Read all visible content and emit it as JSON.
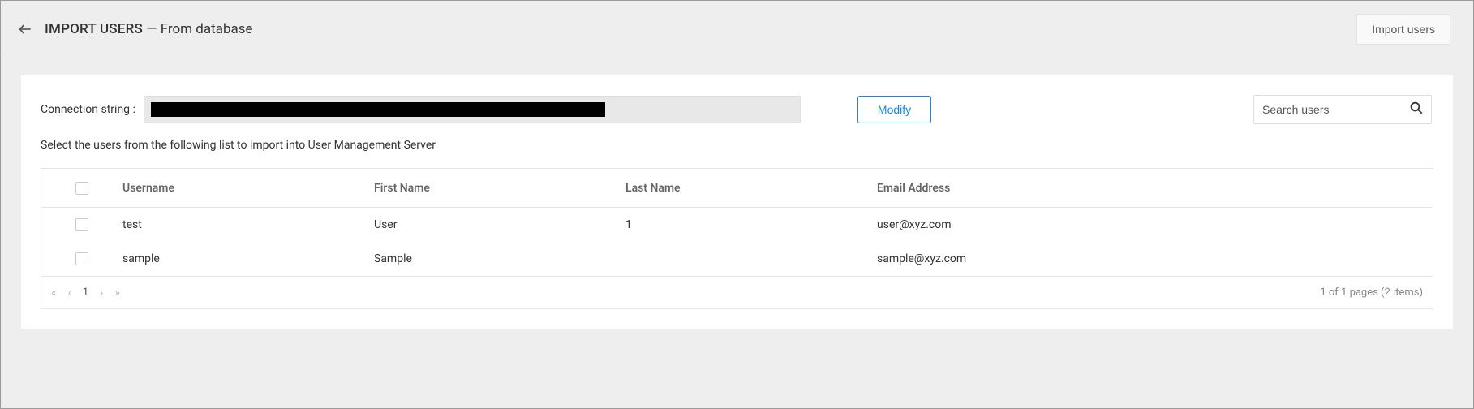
{
  "header": {
    "title_main": "IMPORT USERS",
    "title_separator": " — ",
    "title_sub": "From database",
    "import_button": "Import users"
  },
  "connection": {
    "label": "Connection string :",
    "value_redacted": true,
    "modify_button": "Modify"
  },
  "search": {
    "placeholder": "Search users"
  },
  "hint": "Select the users from the following list to import into User Management Server",
  "table": {
    "columns": {
      "username": "Username",
      "first_name": "First Name",
      "last_name": "Last Name",
      "email": "Email Address"
    },
    "rows": [
      {
        "username": "test",
        "first_name": "User",
        "last_name": "1",
        "email": "user@xyz.com"
      },
      {
        "username": "sample",
        "first_name": "Sample",
        "last_name": "",
        "email": "sample@xyz.com"
      }
    ]
  },
  "pager": {
    "current_page": "1",
    "summary": "1 of 1 pages (2 items)"
  }
}
